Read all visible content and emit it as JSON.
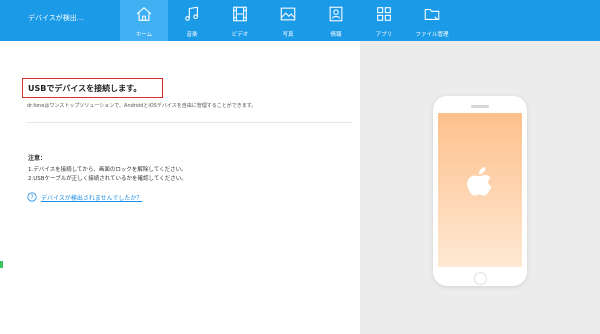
{
  "header": {
    "device_label": "デバイスが検出...",
    "tabs": [
      {
        "label": "ホーム",
        "icon": "home-icon",
        "active": true
      },
      {
        "label": "音楽",
        "icon": "music-icon",
        "active": false
      },
      {
        "label": "ビデオ",
        "icon": "video-icon",
        "active": false
      },
      {
        "label": "写真",
        "icon": "photo-icon",
        "active": false
      },
      {
        "label": "情報",
        "icon": "contacts-icon",
        "active": false
      },
      {
        "label": "アプリ",
        "icon": "apps-icon",
        "active": false
      },
      {
        "label": "ファイル管理",
        "icon": "folder-icon",
        "active": false
      }
    ]
  },
  "main": {
    "heading": "USBでデバイスを接続します。",
    "description": "dr.foneはワンストップソリューションで、AndroidとiOSデバイスを自由に管理することができます。",
    "notes_title": "注意：",
    "notes": [
      "1.デバイスを接続してから、画面のロックを解除してください。",
      "2.USBケーブルが正しく接続されているかを確認してください。"
    ],
    "help_link": "デバイスが検出されませんでしたか？"
  },
  "device_panel": {
    "device_icon": "apple-logo-icon"
  },
  "colors": {
    "toolbar": "#1b9ae8",
    "active_tab": "#41b0f3",
    "highlight_border": "#e02b2b",
    "link": "#1e8ee4",
    "panel_bg": "#ececec",
    "screen_top": "#fec08c",
    "screen_bottom": "#fee8d3"
  }
}
